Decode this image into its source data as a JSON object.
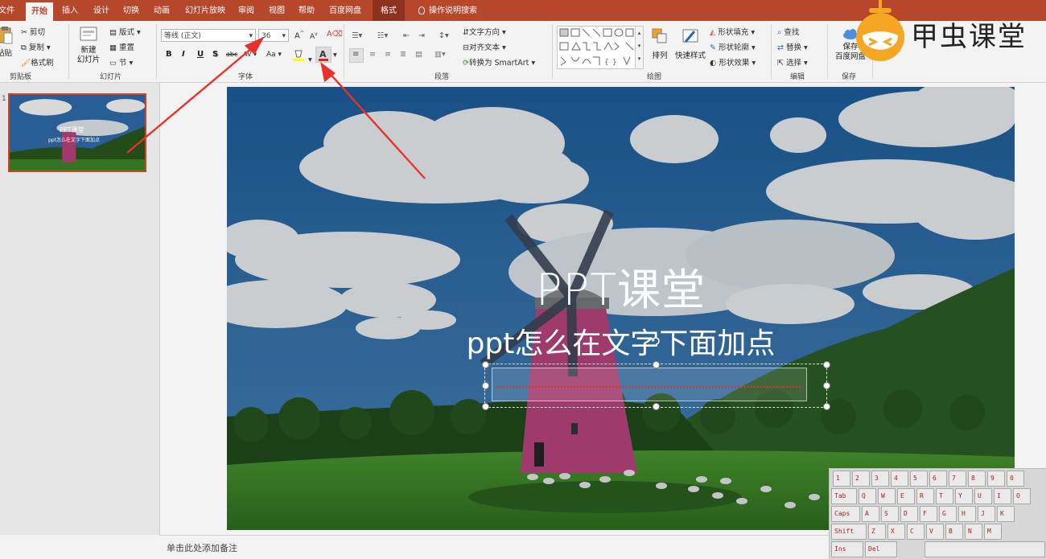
{
  "tabs": [
    "文件",
    "开始",
    "插入",
    "设计",
    "切换",
    "动画",
    "幻灯片放映",
    "审阅",
    "视图",
    "帮助",
    "百度网盘",
    "格式"
  ],
  "tell_me": "操作说明搜索",
  "clipboard": {
    "paste": "粘贴",
    "cut": "剪切",
    "copy": "复制",
    "format_painter": "格式刷",
    "label": "剪贴板"
  },
  "slides_group": {
    "new_slide": "新建\n幻灯片",
    "layout": "版式",
    "reset": "重置",
    "section": "节",
    "label": "幻灯片"
  },
  "font": {
    "name": "等线 (正文)",
    "size": "36",
    "bold": "B",
    "italic": "I",
    "underline": "U",
    "shadow": "S",
    "strike": "abc",
    "spacing": "AV",
    "case": "Aa",
    "grow": "A",
    "shrink": "A",
    "label": "字体"
  },
  "paragraph": {
    "text_direction": "文字方向",
    "align_text": "对齐文本",
    "smartart": "转换为 SmartArt",
    "label": "段落"
  },
  "drawing": {
    "arrange": "排列",
    "quick_styles": "快速样式",
    "shape_fill": "形状填充",
    "shape_outline": "形状轮廓",
    "shape_effects": "形状效果",
    "label": "绘图"
  },
  "editing": {
    "find": "查找",
    "replace": "替换",
    "select": "选择",
    "label": "编辑"
  },
  "save": {
    "save": "保存",
    "baidu": "百度网盘",
    "label": "保存"
  },
  "watermark": {
    "brand": "甲虫课堂"
  },
  "slide": {
    "title": "PPT课堂",
    "subtitle": "ppt怎么在文字下面加点"
  },
  "thumbnail": {
    "number": "1",
    "title": "PPT课堂",
    "subtitle": "ppt怎么在文字下面加点"
  },
  "notes_placeholder": "单击此处添加备注",
  "keyboard": {
    "row1": [
      "1",
      "2",
      "3",
      "4",
      "5",
      "6",
      "7",
      "8",
      "9",
      "0"
    ],
    "row2": [
      "Tab",
      "Q",
      "W",
      "E",
      "R",
      "T",
      "Y",
      "U",
      "I",
      "O"
    ],
    "row3": [
      "Caps",
      "A",
      "S",
      "D",
      "F",
      "G",
      "H",
      "J",
      "K"
    ],
    "row4": [
      "Shift",
      "Z",
      "X",
      "C",
      "V",
      "B",
      "N",
      "M"
    ],
    "row5": [
      "Ins",
      "Del"
    ]
  },
  "colors": {
    "tab_bar": "#b7472a",
    "accent": "#d04423",
    "arrow": "#e8312a",
    "brand_orange": "#f5a623"
  }
}
